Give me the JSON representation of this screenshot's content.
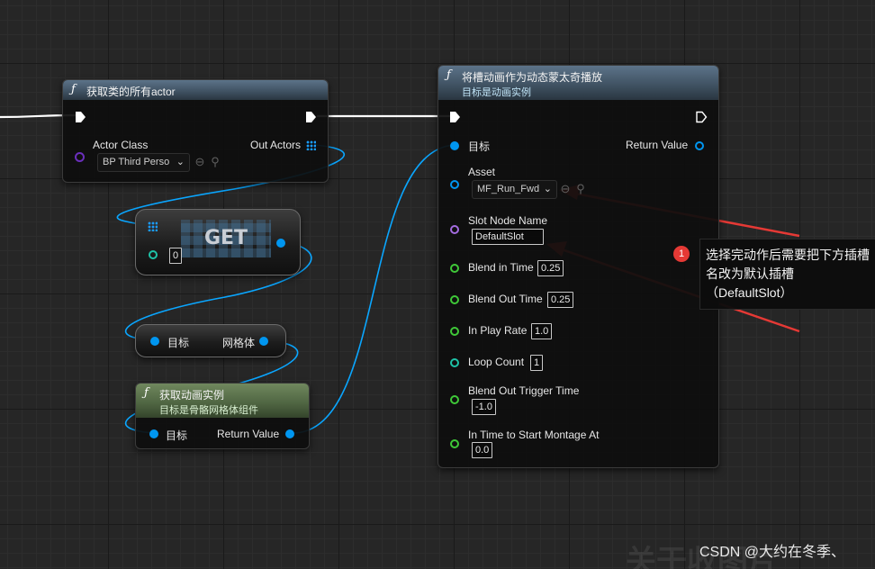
{
  "nodes": {
    "get_all_actors": {
      "title": "获取类的所有actor",
      "actor_class_label": "Actor Class",
      "actor_class_value": "BP Third Perso",
      "out_actors_label": "Out Actors"
    },
    "get": {
      "title": "GET",
      "index_value": "0"
    },
    "mesh_target": {
      "target_label": "目标",
      "mesh_label": "网格体"
    },
    "get_anim_instance": {
      "title": "获取动画实例",
      "subtitle": "目标是骨骼网格体组件",
      "target_label": "目标",
      "return_label": "Return Value"
    },
    "play_slot_anim": {
      "title": "将槽动画作为动态蒙太奇播放",
      "subtitle": "目标是动画实例",
      "target_label": "目标",
      "return_label": "Return Value",
      "asset_label": "Asset",
      "asset_value": "MF_Run_Fwd",
      "slot_label": "Slot Node Name",
      "slot_value": "DefaultSlot",
      "blend_in_label": "Blend in Time",
      "blend_in_value": "0.25",
      "blend_out_label": "Blend Out Time",
      "blend_out_value": "0.25",
      "play_rate_label": "In Play Rate",
      "play_rate_value": "1.0",
      "loop_label": "Loop Count",
      "loop_value": "1",
      "trigger_label": "Blend Out Trigger Time",
      "trigger_value": "-1.0",
      "start_label": "In Time to Start Montage At",
      "start_value": "0.0"
    }
  },
  "annotation": {
    "badge": "1",
    "text": "选择完动作后需要把下方插槽名改为默认插槽（DefaultSlot）"
  },
  "watermark": "CSDN @大约在冬季、",
  "ghost_text": "关于收图片",
  "icons": [
    "function-icon",
    "exec-pin-icon",
    "array-grid-icon",
    "chevron-down-icon",
    "browse-arrow-icon",
    "search-icon"
  ],
  "colors": {
    "exec": "#ffffff",
    "object_pin": "#0096f0",
    "float_pin": "#3fc838",
    "int_pin": "#1ec2a7",
    "name_pin": "#a46ce0",
    "class_pin": "#6a2fbc",
    "annotation_arrow": "#e53935",
    "function_header": "#4a6174",
    "pure_function_header": "#5a7349"
  }
}
